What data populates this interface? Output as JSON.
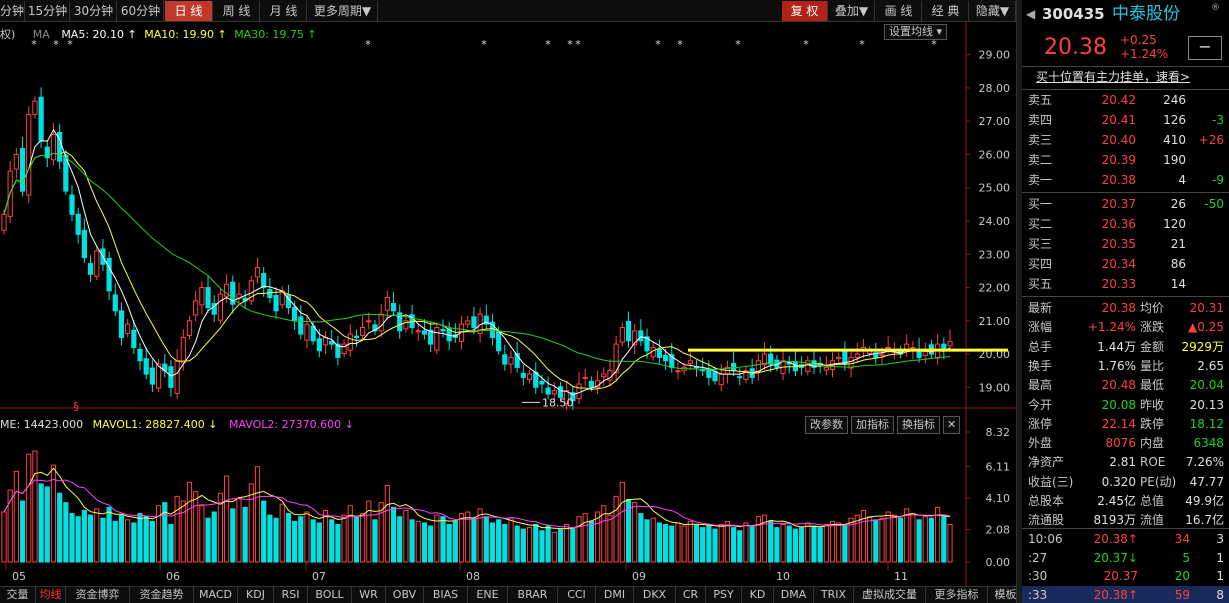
{
  "toolbar": {
    "items": [
      "分钟",
      "15分钟",
      "30分钟",
      "60分钟",
      "日 线",
      "周 线",
      "月 线",
      "更多周期▼"
    ],
    "right": [
      "复 权",
      "叠加▼",
      "画 线",
      "经 典",
      "隐藏▼"
    ]
  },
  "indicator": {
    "prefix": "权)",
    "ma_label": "MA",
    "ma5": "MA5: 20.10",
    "ma10": "MA10: 19.90",
    "ma30": "MA30: 19.75",
    "settings": "设置均线"
  },
  "price_axis": [
    "29.00",
    "28.00",
    "27.00",
    "26.00",
    "25.00",
    "24.00",
    "23.00",
    "22.00",
    "21.00",
    "20.00",
    "19.00"
  ],
  "low_marker": "18.50",
  "vol_info": {
    "vol": "ME: 14423.000",
    "mavol1": "MAVOL1: 28827.400",
    "mavol2": "MAVOL2: 27370.600"
  },
  "vol_buttons": [
    "改参数",
    "加指标",
    "换指标"
  ],
  "vol_axis": [
    "8.32",
    "6.11",
    "4.10",
    "2.08",
    "0.00"
  ],
  "months": [
    "05",
    "06",
    "07",
    "08",
    "09",
    "10",
    "11"
  ],
  "bottom_tabs": [
    "交量",
    "均线",
    "资金博弈",
    "资金趋势",
    "MACD",
    "KDJ",
    "RSI",
    "BOLL",
    "WR",
    "OBV",
    "BIAS",
    "ENE",
    "BRAR",
    "CCI",
    "DMI",
    "DKX",
    "CR",
    "PSY",
    "KD",
    "DMA",
    "TRIX",
    "虚拟成交量",
    "更多指标",
    "模板"
  ],
  "stock": {
    "code": "300435",
    "name": "中泰股份",
    "price": "20.38",
    "change": "+0.25",
    "change_pct": "+1.24%",
    "banner": "买十位置有主力挂单，速看>"
  },
  "asks": [
    {
      "label": "卖五",
      "price": "20.42",
      "vol": "246",
      "chg": ""
    },
    {
      "label": "卖四",
      "price": "20.41",
      "vol": "126",
      "chg": "-3"
    },
    {
      "label": "卖三",
      "price": "20.40",
      "vol": "410",
      "chg": "+26"
    },
    {
      "label": "卖二",
      "price": "20.39",
      "vol": "190",
      "chg": ""
    },
    {
      "label": "卖一",
      "price": "20.38",
      "vol": "4",
      "chg": "-9"
    }
  ],
  "bids": [
    {
      "label": "买一",
      "price": "20.37",
      "vol": "26",
      "chg": "-50"
    },
    {
      "label": "买二",
      "price": "20.36",
      "vol": "120",
      "chg": ""
    },
    {
      "label": "买三",
      "price": "20.35",
      "vol": "21",
      "chg": ""
    },
    {
      "label": "买四",
      "price": "20.34",
      "vol": "86",
      "chg": ""
    },
    {
      "label": "买五",
      "price": "20.33",
      "vol": "14",
      "chg": ""
    }
  ],
  "stats": [
    {
      "l1": "最新",
      "v1": "20.38",
      "l2": "均价",
      "v2": "20.31"
    },
    {
      "l1": "涨幅",
      "v1": "+1.24%",
      "l2": "涨跌",
      "v2": "▲0.25"
    },
    {
      "l1": "总手",
      "v1": "1.44万",
      "l2": "金额",
      "v2": "2929万"
    },
    {
      "l1": "换手",
      "v1": "1.76%",
      "l2": "量比",
      "v2": "2.65"
    },
    {
      "l1": "最高",
      "v1": "20.48",
      "l2": "最低",
      "v2": "20.04"
    },
    {
      "l1": "今开",
      "v1": "20.08",
      "l2": "昨收",
      "v2": "20.13"
    },
    {
      "l1": "涨停",
      "v1": "22.14",
      "l2": "跌停",
      "v2": "18.12"
    },
    {
      "l1": "外盘",
      "v1": "8076",
      "l2": "内盘",
      "v2": "6348"
    },
    {
      "l1": "净资产",
      "v1": "2.81",
      "l2": "ROE",
      "v2": "7.26%"
    },
    {
      "l1": "收益(三)",
      "v1": "0.320",
      "l2": "PE(动)",
      "v2": "47.77"
    },
    {
      "l1": "总股本",
      "v1": "2.45亿",
      "l2": "总值",
      "v2": "49.9亿"
    },
    {
      "l1": "流通股",
      "v1": "8193万",
      "l2": "流值",
      "v2": "16.7亿"
    }
  ],
  "ticks": [
    {
      "t": "10:06",
      "p": "20.38↑",
      "v": "34",
      "n": "3"
    },
    {
      "t": ":27",
      "p": "20.37↓",
      "v": "5",
      "n": "1"
    },
    {
      "t": ":30",
      "p": "20.37",
      "v": "20",
      "n": "1"
    },
    {
      "t": ":33",
      "p": "20.38↑",
      "v": "59",
      "n": "8"
    }
  ],
  "colors": {
    "up": "#ff4040",
    "down": "#00e0e0",
    "ma5": "#ffffff",
    "ma10": "#ffff40",
    "ma30": "#20d020",
    "accent": "#c0392b"
  },
  "chart_data": {
    "type": "candlestick",
    "months": [
      "05",
      "06",
      "07",
      "08",
      "09",
      "10",
      "11"
    ],
    "ylim": [
      18.5,
      29.2
    ],
    "vol_ylim": [
      0,
      8.32
    ],
    "closes": [
      24.2,
      25.5,
      26.0,
      24.9,
      27.2,
      27.6,
      26.4,
      25.9,
      26.6,
      25.8,
      24.9,
      24.2,
      23.6,
      22.9,
      22.4,
      23.1,
      22.7,
      21.9,
      21.3,
      20.5,
      20.9,
      20.2,
      19.8,
      19.4,
      19.1,
      19.7,
      19.5,
      19.0,
      19.8,
      20.5,
      21.0,
      21.6,
      22.0,
      21.4,
      21.2,
      21.8,
      22.1,
      21.5,
      21.8,
      21.6,
      22.2,
      22.6,
      22.0,
      21.7,
      21.3,
      21.9,
      21.4,
      21.0,
      20.6,
      20.9,
      20.4,
      20.1,
      20.5,
      20.3,
      19.9,
      20.3,
      20.6,
      20.5,
      20.8,
      21.0,
      20.7,
      21.2,
      21.7,
      21.3,
      20.7,
      21.0,
      20.8,
      20.7,
      20.6,
      20.3,
      20.8,
      20.7,
      20.4,
      20.5,
      20.9,
      21.0,
      20.8,
      21.2,
      20.9,
      20.5,
      20.1,
      19.7,
      19.9,
      19.6,
      19.3,
      19.4,
      19.0,
      19.1,
      18.8,
      18.9,
      18.7,
      18.9,
      18.6,
      19.1,
      19.3,
      19.0,
      19.2,
      19.4,
      19.5,
      20.3,
      20.8,
      20.4,
      20.7,
      20.4,
      20.1,
      20.2,
      19.9,
      19.8,
      19.6,
      19.5,
      19.6,
      19.8,
      19.6,
      19.5,
      19.3,
      19.2,
      19.4,
      19.6,
      19.5,
      19.3,
      19.5,
      19.3,
      19.8,
      20.0,
      19.7,
      19.6,
      19.8,
      19.7,
      19.5,
      19.6,
      19.8,
      19.6,
      19.7,
      19.6,
      19.8,
      19.9,
      19.7,
      19.9,
      20.0,
      20.2,
      20.1,
      19.9,
      20.0,
      20.2,
      20.1,
      20.0,
      20.3,
      20.2,
      19.9,
      20.1,
      20.0,
      20.3,
      20.13,
      20.38
    ],
    "volumes": [
      3.2,
      4.6,
      5.8,
      3.9,
      6.9,
      7.1,
      5.0,
      4.8,
      6.2,
      4.4,
      3.8,
      3.1,
      2.9,
      3.3,
      3.0,
      3.4,
      2.8,
      3.5,
      2.6,
      3.0,
      2.7,
      2.5,
      3.1,
      2.9,
      2.6,
      3.6,
      3.8,
      2.4,
      4.2,
      3.9,
      5.1,
      4.5,
      3.6,
      2.8,
      3.2,
      4.4,
      5.5,
      3.4,
      4.1,
      3.5,
      5.0,
      6.1,
      3.9,
      3.0,
      2.8,
      3.7,
      3.1,
      2.6,
      2.9,
      3.2,
      2.7,
      2.5,
      3.3,
      2.7,
      2.4,
      3.0,
      3.6,
      2.9,
      3.1,
      3.9,
      2.7,
      3.8,
      4.9,
      3.5,
      2.9,
      3.3,
      2.7,
      2.6,
      2.5,
      2.3,
      3.0,
      2.9,
      2.4,
      2.6,
      3.1,
      3.2,
      2.8,
      3.4,
      2.9,
      2.5,
      2.7,
      2.4,
      2.8,
      2.3,
      2.1,
      2.2,
      2.4,
      2.0,
      2.3,
      1.9,
      2.1,
      2.4,
      2.2,
      2.9,
      3.1,
      2.6,
      3.2,
      3.6,
      3.0,
      4.2,
      5.1,
      4.0,
      3.8,
      3.1,
      2.7,
      2.8,
      2.5,
      2.4,
      2.3,
      2.5,
      2.3,
      2.6,
      2.4,
      2.2,
      2.3,
      2.1,
      2.4,
      2.6,
      2.2,
      2.0,
      2.5,
      2.3,
      2.9,
      3.0,
      2.6,
      2.2,
      2.4,
      2.3,
      2.1,
      2.2,
      2.5,
      2.3,
      2.2,
      2.4,
      2.6,
      2.5,
      2.3,
      2.8,
      3.0,
      3.3,
      2.9,
      2.7,
      2.8,
      3.2,
      3.0,
      2.8,
      3.4,
      3.1,
      2.7,
      2.9,
      2.8,
      3.5,
      2.9,
      2.4
    ]
  }
}
